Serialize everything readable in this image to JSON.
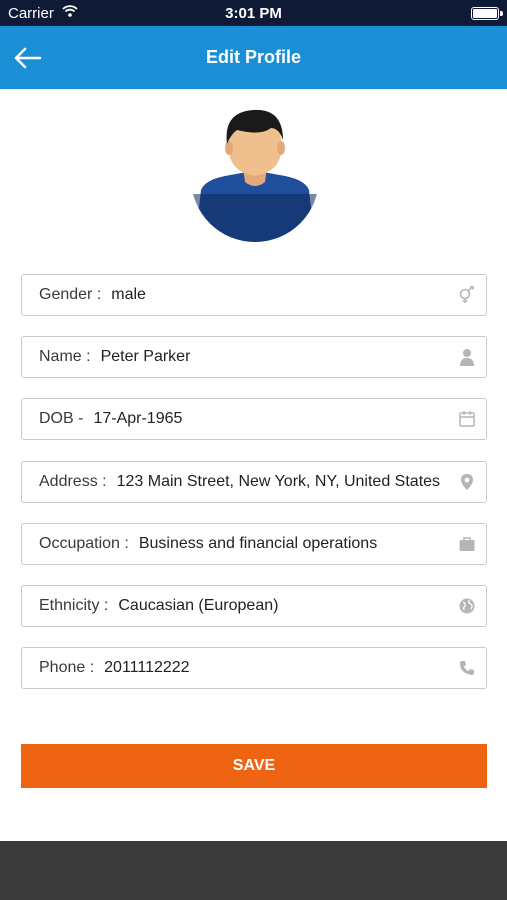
{
  "status_bar": {
    "carrier": "Carrier",
    "time": "3:01 PM",
    "battery": 1.0
  },
  "app_bar": {
    "title": "Edit Profile",
    "back_icon": "arrow-left-icon"
  },
  "avatar": {
    "icon": "user-avatar"
  },
  "fields": {
    "gender": {
      "label": "Gender :",
      "value": "male",
      "icon": "gender-icon"
    },
    "name": {
      "label": "Name :",
      "value": "Peter Parker",
      "icon": "person-icon"
    },
    "dob": {
      "label": "DOB -",
      "value": "17-Apr-1965",
      "icon": "calendar-icon"
    },
    "address": {
      "label": "Address :",
      "value": "123 Main Street, New York, NY, United States",
      "icon": "location-pin-icon"
    },
    "occupation": {
      "label": "Occupation :",
      "value": "Business and financial operations",
      "icon": "briefcase-icon"
    },
    "ethnicity": {
      "label": "Ethnicity :",
      "value": "Caucasian (European)",
      "icon": "globe-icon"
    },
    "phone": {
      "label": "Phone :",
      "value": "2011112222",
      "icon": "phone-icon"
    }
  },
  "save_button": {
    "label": "SAVE"
  },
  "colors": {
    "status_bar": "#0e1a36",
    "app_bar": "#1b8fd5",
    "save": "#ef6413",
    "bottom_bar": "#3a3a3a",
    "field_border": "#c9c9c9",
    "icon": "#b5b5b5"
  }
}
